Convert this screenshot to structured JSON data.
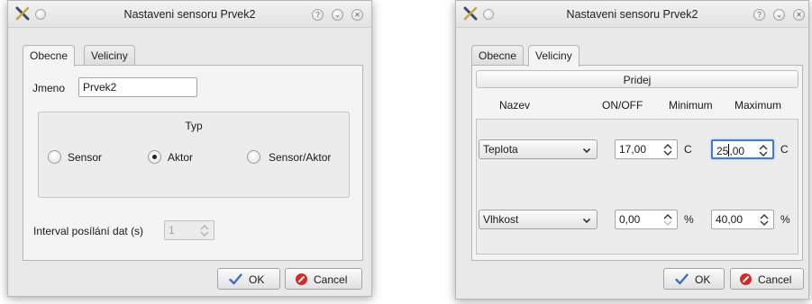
{
  "left_dialog": {
    "title": "Nastaveni sensoru Prvek2",
    "tabs": [
      "Obecne",
      "Veliciny"
    ],
    "name_label": "Jmeno",
    "name_value": "Prvek2",
    "type_group_title": "Typ",
    "radio_sensor": "Sensor",
    "radio_aktor": "Aktor",
    "radio_sensor_aktor": "Sensor/Aktor",
    "selected_type": "Aktor",
    "interval_label": "Interval posílání dat (s)",
    "interval_value": "1",
    "ok_label": "OK",
    "cancel_label": "Cancel"
  },
  "right_dialog": {
    "title": "Nastaveni sensoru Prvek2",
    "tabs": [
      "Obecne",
      "Veliciny"
    ],
    "add_button_label": "Pridej",
    "headers": {
      "name": "Nazev",
      "onoff": "ON/OFF",
      "minimum": "Minimum",
      "maximum": "Maximum"
    },
    "rows": [
      {
        "name": "Teplota",
        "onoff": "17,00",
        "unit1": "C",
        "max_before_caret": "25",
        "max_after_caret": ",00",
        "unit2": "C"
      },
      {
        "name": "Vlhkost",
        "onoff": "0,00",
        "unit1": "%",
        "max": "40,00",
        "unit2": "%"
      }
    ],
    "ok_label": "OK",
    "cancel_label": "Cancel"
  },
  "icons": {
    "app": "tools-icon",
    "help": "help-icon",
    "minimize": "minimize-icon",
    "close": "close-icon",
    "ok": "checkmark-icon",
    "cancel": "cancel-icon",
    "spin": "spin-arrows-icon",
    "dropdown": "chevron-down-icon"
  },
  "colors": {
    "window_bg": "#e9e9e9",
    "focus_border": "#3b7de0",
    "cancel_red": "#d62a2a",
    "ok_blue": "#3d6fc2"
  }
}
